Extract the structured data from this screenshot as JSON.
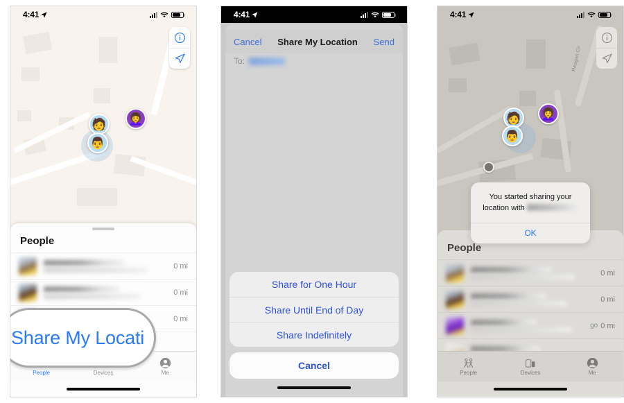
{
  "panels": [
    {
      "id": "panel-find-my-people",
      "status_bar": {
        "time": "4:41",
        "location_icon": "location-arrow-icon",
        "signal_icon": "cellular-bars-icon",
        "wifi_icon": "wifi-icon",
        "battery_icon": "battery-icon"
      },
      "map": {
        "info_button": "info-icon",
        "locate_button": "locate-arrow-icon",
        "street_label": ""
      },
      "sheet": {
        "title": "People",
        "rows": [
          {
            "distance": "0 mi",
            "go": ""
          },
          {
            "distance": "0 mi",
            "go": ""
          },
          {
            "distance": "0 mi",
            "go": ""
          },
          {
            "distance": "",
            "go": ""
          }
        ]
      },
      "callout": {
        "label": "Share My Locati"
      },
      "tabs": [
        {
          "label": "People",
          "icon": "people-icon",
          "active": true
        },
        {
          "label": "Devices",
          "icon": "devices-icon",
          "active": false
        },
        {
          "label": "Me",
          "icon": "person-circle-icon",
          "active": false
        }
      ]
    },
    {
      "id": "panel-share-my-location-modal",
      "status_bar": {
        "time": "4:41",
        "location_icon": "location-arrow-icon",
        "signal_icon": "cellular-bars-icon",
        "wifi_icon": "wifi-icon",
        "battery_icon": "battery-icon"
      },
      "nav": {
        "cancel": "Cancel",
        "title": "Share My Location",
        "send": "Send"
      },
      "to_field": {
        "label": "To:",
        "value": ""
      },
      "contact_rows": 9,
      "action_sheet": {
        "options": [
          "Share for One Hour",
          "Share Until End of Day",
          "Share Indefinitely"
        ],
        "cancel": "Cancel"
      }
    },
    {
      "id": "panel-sharing-confirmation",
      "status_bar": {
        "time": "4:41",
        "location_icon": "location-arrow-icon",
        "signal_icon": "cellular-bars-icon",
        "wifi_icon": "wifi-icon",
        "battery_icon": "battery-icon"
      },
      "map": {
        "info_button": "info-icon",
        "locate_button": "locate-arrow-icon",
        "street_label": "Reagan Cir"
      },
      "alert": {
        "message_before": "You started sharing your location with",
        "message_redacted": "",
        "ok": "OK"
      },
      "sheet": {
        "title": "People",
        "rows": [
          {
            "distance": "0 mi",
            "go": ""
          },
          {
            "distance": "0 mi",
            "go": ""
          },
          {
            "distance": "0 mi",
            "go": "go"
          },
          {
            "distance": "",
            "go": ""
          }
        ]
      },
      "tabs": [
        {
          "label": "People",
          "icon": "people-icon",
          "active": false
        },
        {
          "label": "Devices",
          "icon": "devices-icon",
          "active": false
        },
        {
          "label": "Me",
          "icon": "person-circle-icon",
          "active": false
        }
      ]
    }
  ],
  "colors": {
    "accent_blue": "#2a7bf6",
    "sheet_blue": "#2f52d8",
    "map_warm": "#f8f3ed",
    "map_dim": "#c9c6c0"
  }
}
